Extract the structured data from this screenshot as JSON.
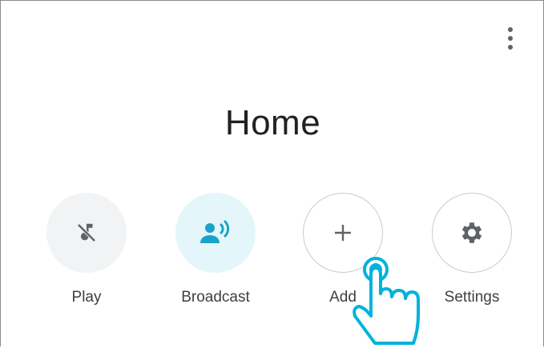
{
  "header": {
    "menu_icon": "more-vert-icon"
  },
  "title": "Home",
  "actions": [
    {
      "label": "Play",
      "icon": "music-off-icon"
    },
    {
      "label": "Broadcast",
      "icon": "broadcast-icon"
    },
    {
      "label": "Add",
      "icon": "add-icon"
    },
    {
      "label": "Settings",
      "icon": "gear-icon"
    }
  ],
  "colors": {
    "broadcast_accent": "#1aa3c9",
    "pointer": "#00b3dc",
    "icon": "#5f6368"
  }
}
